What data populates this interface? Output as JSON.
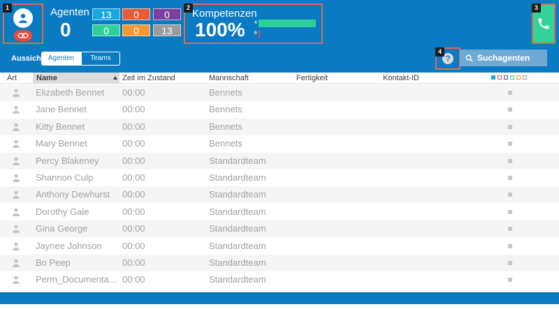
{
  "header": {
    "badges": [
      "1",
      "2",
      "3",
      "4"
    ],
    "agents": {
      "label": "Agenten",
      "count": "0",
      "tiles": [
        {
          "value": "13",
          "color": "#19a7e0"
        },
        {
          "value": "0",
          "color": "#e85a3c"
        },
        {
          "value": "0",
          "color": "#7a3e9d"
        },
        {
          "value": "0",
          "color": "#2ed09a"
        },
        {
          "value": "0",
          "color": "#f29a32"
        },
        {
          "value": "13",
          "color": "#9b9b9b"
        }
      ]
    },
    "skills": {
      "label": "Kompetenzen",
      "percent": "100%",
      "bars": [
        {
          "label": "4",
          "fraction": 1.0
        },
        {
          "label": "0",
          "fraction": 0.0
        }
      ]
    },
    "phone_icon": "phone-icon",
    "avatar_icon": "user-icon",
    "logout_icon": "logout-icon"
  },
  "toolbar": {
    "view_label": "Aussicht",
    "seg_agents": "Agenten",
    "seg_teams": "Teams",
    "help_label": "?",
    "search_label": "Suchagenten"
  },
  "table": {
    "columns": {
      "type": "Art",
      "name": "Name",
      "time": "Zeit im Zustand",
      "team": "Mannschaft",
      "skill": "Fertigkeit",
      "contact": "Kontakt-ID"
    },
    "legend_colors": [
      "#19a7e0",
      "#e85a3c",
      "#7a3e9d",
      "#2ed09a",
      "#f29a32",
      "#9b9b9b"
    ],
    "rows": [
      {
        "name": "Elizabeth Bennet",
        "time": "00:00",
        "team": "Bennets"
      },
      {
        "name": "Jane Bennet",
        "time": "00:00",
        "team": "Bennets"
      },
      {
        "name": "Kitty Bennet",
        "time": "00:00",
        "team": "Bennets"
      },
      {
        "name": "Mary Bennet",
        "time": "00:00",
        "team": "Bennets"
      },
      {
        "name": "Percy Blakeney",
        "time": "00:00",
        "team": "Standardteam"
      },
      {
        "name": "Shannon Culp",
        "time": "00:00",
        "team": "Standardteam"
      },
      {
        "name": "Anthony Dewhurst",
        "time": "00:00",
        "team": "Standardteam"
      },
      {
        "name": "Dorothy Gale",
        "time": "00:00",
        "team": "Standardteam"
      },
      {
        "name": "Gina George",
        "time": "00:00",
        "team": "Standardteam"
      },
      {
        "name": "Jaynee Johnson",
        "time": "00:00",
        "team": "Standardteam"
      },
      {
        "name": "Bo Peep",
        "time": "00:00",
        "team": "Standardteam"
      },
      {
        "name": "Perm_Documenta…",
        "time": "00:00",
        "team": "Standardteam"
      }
    ]
  }
}
